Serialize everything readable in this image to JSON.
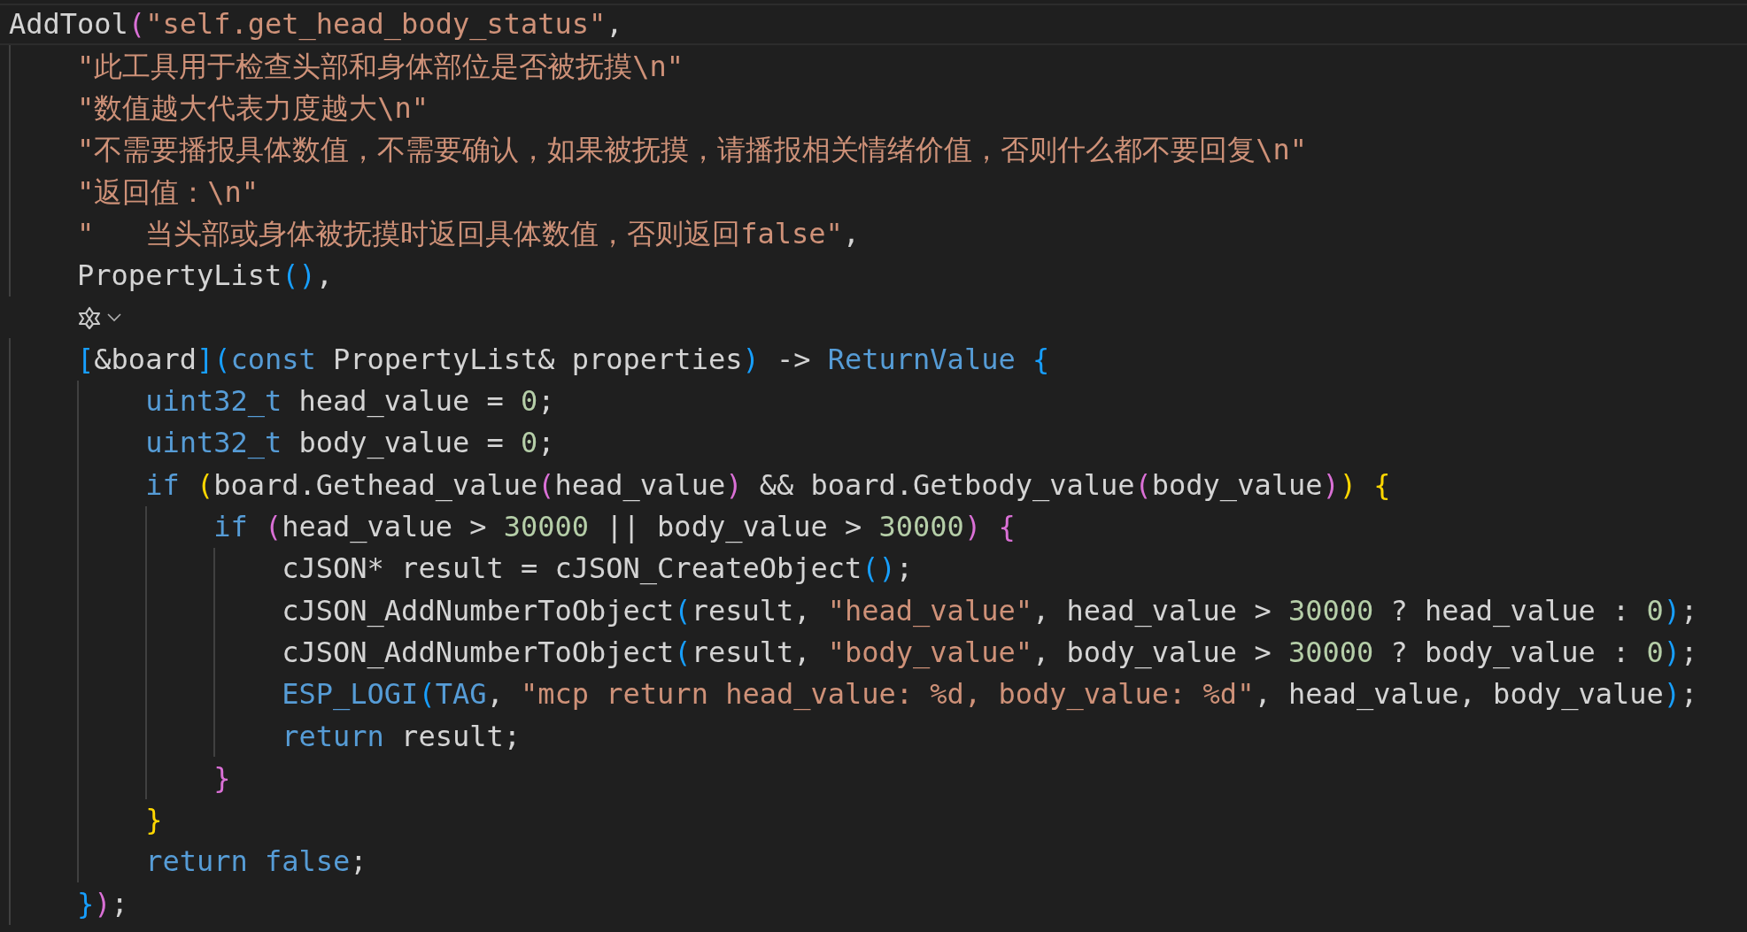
{
  "editor": {
    "lines": [
      {
        "kind": "code",
        "current": true,
        "tokens": [
          {
            "kind": "plain",
            "text": "AddTool"
          },
          {
            "kind": "bracket2",
            "text": "("
          },
          {
            "kind": "string",
            "text": "\"self.get_head_body_status\""
          },
          {
            "kind": "plain",
            "text": ","
          }
        ]
      },
      {
        "kind": "code",
        "current": false,
        "tokens": [
          {
            "kind": "string",
            "text": "    \"此工具用于检查头部和身体部位是否被抚摸\\n\""
          }
        ]
      },
      {
        "kind": "code",
        "current": false,
        "tokens": [
          {
            "kind": "string",
            "text": "    \"数值越大代表力度越大\\n\""
          }
        ]
      },
      {
        "kind": "code",
        "current": false,
        "tokens": [
          {
            "kind": "string",
            "text": "    \"不需要播报具体数值，不需要确认，如果被抚摸，请播报相关情绪价值，否则什么都不要回复\\n\""
          }
        ]
      },
      {
        "kind": "code",
        "current": false,
        "tokens": [
          {
            "kind": "string",
            "text": "    \"返回值：\\n\""
          }
        ]
      },
      {
        "kind": "code",
        "current": false,
        "tokens": [
          {
            "kind": "string",
            "text": "    \"   当头部或身体被抚摸时返回具体数值，否则返回false\""
          },
          {
            "kind": "plain",
            "text": ","
          }
        ]
      },
      {
        "kind": "code",
        "current": false,
        "tokens": [
          {
            "kind": "plain",
            "text": "    PropertyList"
          },
          {
            "kind": "bracket3",
            "text": "()"
          },
          {
            "kind": "plain",
            "text": ","
          }
        ]
      },
      {
        "kind": "codelens",
        "current": false
      },
      {
        "kind": "code",
        "current": false,
        "tokens": [
          {
            "kind": "bracket3",
            "text": "    ["
          },
          {
            "kind": "plain",
            "text": "&board"
          },
          {
            "kind": "bracket3",
            "text": "]("
          },
          {
            "kind": "keyword",
            "text": "const"
          },
          {
            "kind": "plain",
            "text": " PropertyList& properties"
          },
          {
            "kind": "bracket3",
            "text": ")"
          },
          {
            "kind": "plain",
            "text": " -> "
          },
          {
            "kind": "keyword",
            "text": "ReturnValue"
          },
          {
            "kind": "bracket3",
            "text": " {"
          }
        ]
      },
      {
        "kind": "code",
        "current": false,
        "tokens": [
          {
            "kind": "keyword",
            "text": "        uint32_t"
          },
          {
            "kind": "plain",
            "text": " head_value = "
          },
          {
            "kind": "number",
            "text": "0"
          },
          {
            "kind": "plain",
            "text": ";"
          }
        ]
      },
      {
        "kind": "code",
        "current": false,
        "tokens": [
          {
            "kind": "keyword",
            "text": "        uint32_t"
          },
          {
            "kind": "plain",
            "text": " body_value = "
          },
          {
            "kind": "number",
            "text": "0"
          },
          {
            "kind": "plain",
            "text": ";"
          }
        ]
      },
      {
        "kind": "code",
        "current": false,
        "tokens": [
          {
            "kind": "keyword",
            "text": "        if"
          },
          {
            "kind": "bracket1",
            "text": " ("
          },
          {
            "kind": "plain",
            "text": "board.Gethead_value"
          },
          {
            "kind": "bracket2",
            "text": "("
          },
          {
            "kind": "plain",
            "text": "head_value"
          },
          {
            "kind": "bracket2",
            "text": ")"
          },
          {
            "kind": "plain",
            "text": " && board.Getbody_value"
          },
          {
            "kind": "bracket2",
            "text": "("
          },
          {
            "kind": "plain",
            "text": "body_value"
          },
          {
            "kind": "bracket2",
            "text": ")"
          },
          {
            "kind": "bracket1",
            "text": ")"
          },
          {
            "kind": "bracket1",
            "text": " {"
          }
        ]
      },
      {
        "kind": "code",
        "current": false,
        "tokens": [
          {
            "kind": "keyword",
            "text": "            if"
          },
          {
            "kind": "bracket2",
            "text": " ("
          },
          {
            "kind": "plain",
            "text": "head_value > "
          },
          {
            "kind": "number",
            "text": "30000"
          },
          {
            "kind": "plain",
            "text": " || body_value > "
          },
          {
            "kind": "number",
            "text": "30000"
          },
          {
            "kind": "bracket2",
            "text": ")"
          },
          {
            "kind": "bracket2",
            "text": " {"
          }
        ]
      },
      {
        "kind": "code",
        "current": false,
        "tokens": [
          {
            "kind": "plain",
            "text": "                cJSON* result = cJSON_CreateObject"
          },
          {
            "kind": "bracket3",
            "text": "()"
          },
          {
            "kind": "plain",
            "text": ";"
          }
        ]
      },
      {
        "kind": "code",
        "current": false,
        "tokens": [
          {
            "kind": "plain",
            "text": "                cJSON_AddNumberToObject"
          },
          {
            "kind": "bracket3",
            "text": "("
          },
          {
            "kind": "plain",
            "text": "result, "
          },
          {
            "kind": "string",
            "text": "\"head_value\""
          },
          {
            "kind": "plain",
            "text": ", head_value > "
          },
          {
            "kind": "number",
            "text": "30000"
          },
          {
            "kind": "plain",
            "text": " ? head_value : "
          },
          {
            "kind": "number",
            "text": "0"
          },
          {
            "kind": "bracket3",
            "text": ")"
          },
          {
            "kind": "plain",
            "text": ";"
          }
        ]
      },
      {
        "kind": "code",
        "current": false,
        "tokens": [
          {
            "kind": "plain",
            "text": "                cJSON_AddNumberToObject"
          },
          {
            "kind": "bracket3",
            "text": "("
          },
          {
            "kind": "plain",
            "text": "result, "
          },
          {
            "kind": "string",
            "text": "\"body_value\""
          },
          {
            "kind": "plain",
            "text": ", body_value > "
          },
          {
            "kind": "number",
            "text": "30000"
          },
          {
            "kind": "plain",
            "text": " ? body_value : "
          },
          {
            "kind": "number",
            "text": "0"
          },
          {
            "kind": "bracket3",
            "text": ")"
          },
          {
            "kind": "plain",
            "text": ";"
          }
        ]
      },
      {
        "kind": "code",
        "current": false,
        "tokens": [
          {
            "kind": "keyword",
            "text": "                ESP_LOGI"
          },
          {
            "kind": "bracket3",
            "text": "("
          },
          {
            "kind": "keyword",
            "text": "TAG"
          },
          {
            "kind": "plain",
            "text": ", "
          },
          {
            "kind": "string",
            "text": "\"mcp return head_value: %d, body_value: %d\""
          },
          {
            "kind": "plain",
            "text": ", head_value, body_value"
          },
          {
            "kind": "bracket3",
            "text": ")"
          },
          {
            "kind": "plain",
            "text": ";"
          }
        ]
      },
      {
        "kind": "code",
        "current": false,
        "tokens": [
          {
            "kind": "keyword",
            "text": "                return"
          },
          {
            "kind": "plain",
            "text": " result;"
          }
        ]
      },
      {
        "kind": "code",
        "current": false,
        "tokens": [
          {
            "kind": "bracket2",
            "text": "            }"
          }
        ]
      },
      {
        "kind": "code",
        "current": false,
        "tokens": [
          {
            "kind": "bracket1",
            "text": "        }"
          }
        ]
      },
      {
        "kind": "code",
        "current": false,
        "tokens": [
          {
            "kind": "keyword",
            "text": "        return"
          },
          {
            "kind": "keyword",
            "text": " false"
          },
          {
            "kind": "plain",
            "text": ";"
          }
        ]
      },
      {
        "kind": "code",
        "current": false,
        "tokens": [
          {
            "kind": "bracket3",
            "text": "    }"
          },
          {
            "kind": "bracket2",
            "text": ")"
          },
          {
            "kind": "plain",
            "text": ";"
          }
        ]
      }
    ]
  }
}
